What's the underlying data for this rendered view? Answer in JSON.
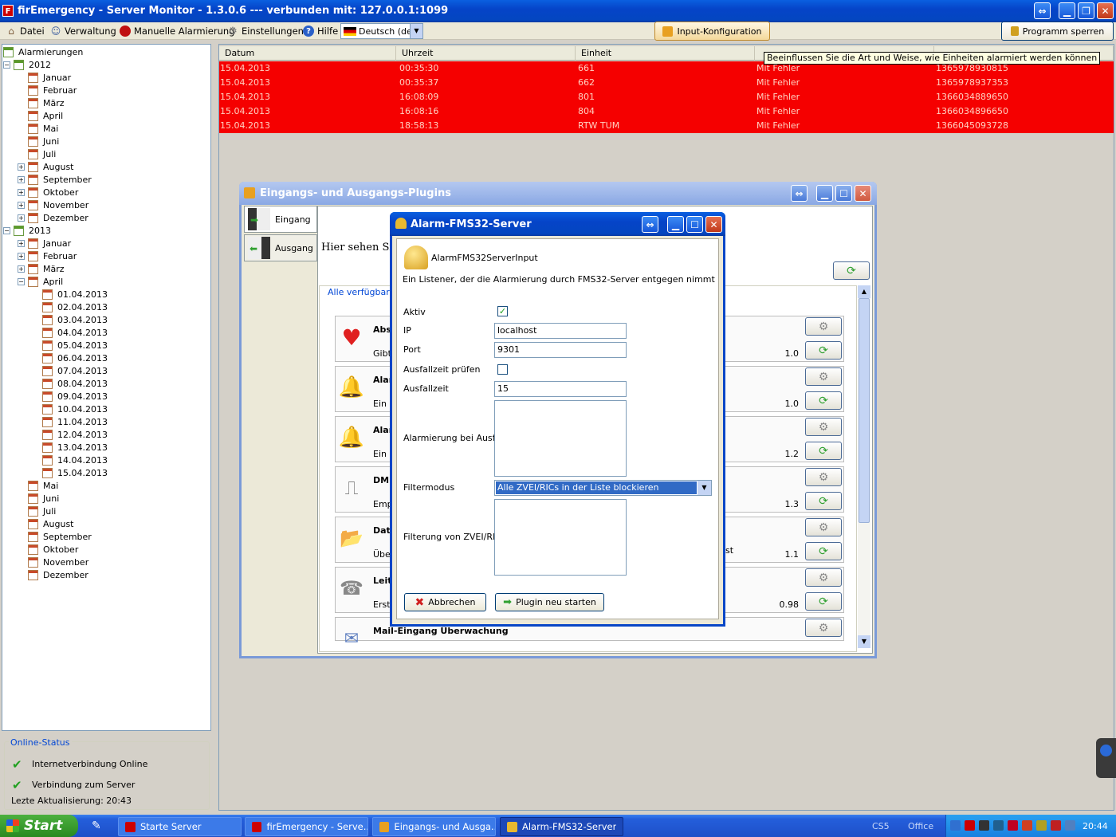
{
  "main_window": {
    "title": "firEmergency - Server Monitor - 1.3.0.6 --- verbunden mit: 127.0.0.1:1099",
    "icon": "firemergency-app-icon",
    "title_buttons": [
      "resize-toggle",
      "minimize",
      "restore",
      "close"
    ]
  },
  "menu": {
    "datei": "Datei",
    "verwaltung": "Verwaltung",
    "manuelle": "Manuelle Alarmierung",
    "einstellungen": "Einstellungen",
    "hilfe": "Hilfe",
    "language": "Deutsch (de)",
    "input_config": "Input-Konfiguration",
    "lock": "Programm sperren"
  },
  "tooltip": "Beeinflussen Sie die Art und Weise, wie Einheiten alarmiert werden können",
  "tree": {
    "root": "Alarmierungen",
    "years": [
      {
        "label": "2012",
        "months": [
          "Januar",
          "Februar",
          "März",
          "April",
          "Mai",
          "Juni",
          "Juli",
          "August",
          "September",
          "Oktober",
          "November",
          "Dezember"
        ]
      },
      {
        "label": "2013",
        "months_before": [
          "Januar",
          "Februar",
          "März",
          "April"
        ],
        "days": [
          "01.04.2013",
          "02.04.2013",
          "03.04.2013",
          "04.04.2013",
          "05.04.2013",
          "06.04.2013",
          "07.04.2013",
          "08.04.2013",
          "09.04.2013",
          "10.04.2013",
          "11.04.2013",
          "12.04.2013",
          "13.04.2013",
          "14.04.2013",
          "15.04.2013"
        ],
        "months_after": [
          "Mai",
          "Juni",
          "Juli",
          "August",
          "September",
          "Oktober",
          "November",
          "Dezember"
        ]
      }
    ]
  },
  "status": {
    "title": "Online-Status",
    "internet": "Internetverbindung Online",
    "server": "Verbindung zum Server",
    "last_update": "Lezte Aktualisierung: 20:43"
  },
  "table": {
    "headers": [
      "Datum",
      "Uhrzeit",
      "Einheit"
    ],
    "rows": [
      [
        "15.04.2013",
        "00:35:30",
        "661",
        "Mit Fehler",
        "1365978930815"
      ],
      [
        "15.04.2013",
        "00:35:37",
        "662",
        "Mit Fehler",
        "1365978937353"
      ],
      [
        "15.04.2013",
        "16:08:09",
        "801",
        "Mit Fehler",
        "1366034889650"
      ],
      [
        "15.04.2013",
        "16:08:16",
        "804",
        "Mit Fehler",
        "1366034896650"
      ],
      [
        "15.04.2013",
        "18:58:13",
        "RTW TUM",
        "Mit Fehler",
        "1366045093728"
      ]
    ]
  },
  "plugins_window": {
    "title": "Eingangs- und Ausgangs-Plugins",
    "tab_in": "Eingang",
    "tab_out": "Ausgang",
    "intro": "Hier sehen Sie a",
    "group": "Alle verfügbaren",
    "cards": [
      {
        "name": "Abs",
        "desc": "Gibt",
        "version": "1.0",
        "icon": "heart-icon"
      },
      {
        "name": "Alar",
        "desc": "Ein L",
        "version": "1.0",
        "icon": "bell-icon"
      },
      {
        "name": "Alar",
        "desc": "Ein L",
        "version": "1.2",
        "icon": "bell-icon"
      },
      {
        "name": "DME",
        "desc": "Emp",
        "version": "1.3",
        "icon": "pager-icon"
      },
      {
        "name": "Dat",
        "desc": "Über",
        "version": "1.1",
        "icon": "folder-search-icon",
        "desc_tail": "st"
      },
      {
        "name": "Leit",
        "desc": "Erste",
        "version": "0.98",
        "icon": "fax-icon"
      },
      {
        "name": "Mail-Eingang Überwachung",
        "desc": "",
        "version": "",
        "icon": "mail-icon"
      }
    ]
  },
  "dialog": {
    "title": "Alarm-FMS32-Server",
    "plugin_name": "AlarmFMS32ServerInput",
    "description": "Ein Listener, der die Alarmierung durch FMS32-Server entgegen nimmt",
    "labels": {
      "aktiv": "Aktiv",
      "ip": "IP",
      "port": "Port",
      "ausfall_pruefen": "Ausfallzeit prüfen",
      "ausfallzeit": "Ausfallzeit",
      "alarm_ausfall": "Alarmierung bei Ausfall",
      "filtermodus": "Filtermodus",
      "filterung": "Filterung von ZVEI/RIC"
    },
    "values": {
      "ip": "localhost",
      "port": "9301",
      "ausfallzeit": "15",
      "filtermodus": "Alle ZVEI/RICs in der Liste blockieren"
    },
    "cancel": "Abbrechen",
    "restart": "Plugin neu starten"
  },
  "taskbar": {
    "start": "Start",
    "items": [
      "Starte Server",
      "firEmergency - Serve...",
      "Eingangs- und Ausga...",
      "Alarm-FMS32-Server"
    ],
    "toolbars": [
      "CS5",
      "Office"
    ],
    "clock": "20:44"
  },
  "colors": {
    "error_row": "#f50000",
    "xp_blue": "#0846c7",
    "taskbar": "#245edb",
    "start": "#3c9a30"
  }
}
